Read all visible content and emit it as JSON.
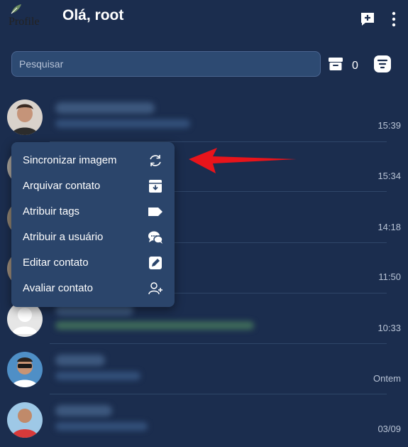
{
  "header": {
    "profile_alt": "Profile",
    "greeting": "Olá, root"
  },
  "search": {
    "placeholder": "Pesquisar",
    "archived_count": "0"
  },
  "chats": [
    {
      "time": "15:39",
      "avatar": "photo"
    },
    {
      "time": "15:34",
      "avatar": "photo"
    },
    {
      "time": "14:18",
      "avatar": "photo"
    },
    {
      "time": "11:50",
      "avatar": "photo"
    },
    {
      "time": "10:33",
      "avatar": "default"
    },
    {
      "time": "Ontem",
      "avatar": "photo"
    },
    {
      "time": "03/09",
      "avatar": "photo"
    }
  ],
  "context_menu": [
    {
      "label": "Sincronizar imagem",
      "icon": "sync-icon"
    },
    {
      "label": "Arquivar contato",
      "icon": "archive-icon"
    },
    {
      "label": "Atribuir tags",
      "icon": "tag-icon"
    },
    {
      "label": "Atribuir a usuário",
      "icon": "chat-bubbles-icon"
    },
    {
      "label": "Editar contato",
      "icon": "pencil-icon"
    },
    {
      "label": "Avaliar contato",
      "icon": "user-plus-icon"
    }
  ],
  "colors": {
    "background": "#1b2d4e",
    "menu": "#2b456b",
    "search": "#2d4a72",
    "annotation_arrow": "#e8141b"
  }
}
